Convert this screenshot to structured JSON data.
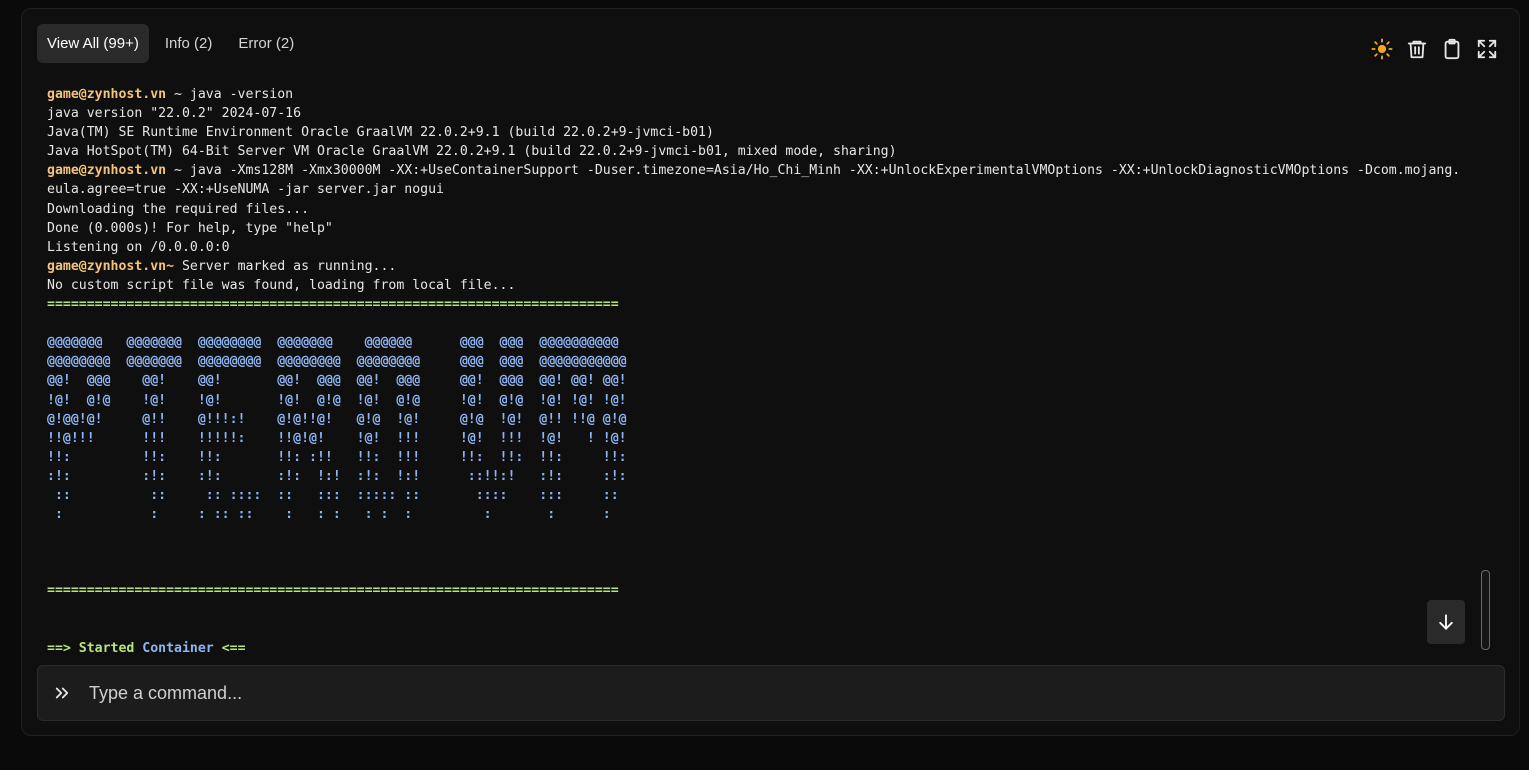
{
  "tabs": [
    {
      "label": "View All (99+)",
      "active": true
    },
    {
      "label": "Info (2)",
      "active": false
    },
    {
      "label": "Error (2)",
      "active": false
    }
  ],
  "toolbar": {
    "icons": [
      "sun-icon",
      "trash-icon",
      "clipboard-icon",
      "expand-icon"
    ],
    "sun_color": "#f5a623"
  },
  "console": {
    "lines": [
      {
        "segments": [
          {
            "text": "game@zynhost.vn",
            "style": "prompt"
          },
          {
            "text": " ~ java -version",
            "style": "plain"
          }
        ]
      },
      {
        "segments": [
          {
            "text": "java version \"22.0.2\" 2024-07-16",
            "style": "plain"
          }
        ]
      },
      {
        "segments": [
          {
            "text": "Java(TM) SE Runtime Environment Oracle GraalVM 22.0.2+9.1 (build 22.0.2+9-jvmci-b01)",
            "style": "plain"
          }
        ]
      },
      {
        "segments": [
          {
            "text": "Java HotSpot(TM) 64-Bit Server VM Oracle GraalVM 22.0.2+9.1 (build 22.0.2+9-jvmci-b01, mixed mode, sharing)",
            "style": "plain"
          }
        ]
      },
      {
        "segments": [
          {
            "text": "game@zynhost.vn",
            "style": "prompt"
          },
          {
            "text": " ~ java -Xms128M -Xmx30000M -XX:+UseContainerSupport -Duser.timezone=Asia/Ho_Chi_Minh -XX:+UnlockExperimentalVMOptions -XX:+UnlockDiagnosticVMOptions -Dcom.mojang.",
            "style": "plain"
          }
        ]
      },
      {
        "segments": [
          {
            "text": "eula.agree=true -XX:+UseNUMA -jar server.jar nogui",
            "style": "plain"
          }
        ]
      },
      {
        "segments": [
          {
            "text": "Downloading the required files...",
            "style": "plain"
          }
        ]
      },
      {
        "segments": [
          {
            "text": "Done (0.000s)! For help, type \"help\"",
            "style": "plain"
          }
        ]
      },
      {
        "segments": [
          {
            "text": "Listening on /0.0.0.0:0",
            "style": "plain"
          }
        ]
      },
      {
        "segments": [
          {
            "text": "game@zynhost.vn~",
            "style": "prompt"
          },
          {
            "text": " Server marked as running...",
            "style": "plain"
          }
        ]
      },
      {
        "segments": [
          {
            "text": "No custom script file was found, loading from local file...",
            "style": "plain"
          }
        ]
      },
      {
        "segments": [
          {
            "text": "========================================================================",
            "style": "sep"
          }
        ]
      },
      {
        "segments": [
          {
            "text": "",
            "style": "plain"
          }
        ]
      },
      {
        "segments": [
          {
            "text": "@@@@@@@   @@@@@@@  @@@@@@@@  @@@@@@@    @@@@@@      @@@  @@@  @@@@@@@@@@",
            "style": "ascii"
          }
        ]
      },
      {
        "segments": [
          {
            "text": "@@@@@@@@  @@@@@@@  @@@@@@@@  @@@@@@@@  @@@@@@@@     @@@  @@@  @@@@@@@@@@@",
            "style": "ascii"
          }
        ]
      },
      {
        "segments": [
          {
            "text": "@@!  @@@    @@!    @@!       @@!  @@@  @@!  @@@     @@!  @@@  @@! @@! @@!",
            "style": "ascii"
          }
        ]
      },
      {
        "segments": [
          {
            "text": "!@!  @!@    !@!    !@!       !@!  @!@  !@!  @!@     !@!  @!@  !@! !@! !@!",
            "style": "ascii"
          }
        ]
      },
      {
        "segments": [
          {
            "text": "@!@@!@!     @!!    @!!!:!    @!@!!@!   @!@  !@!     @!@  !@!  @!! !!@ @!@",
            "style": "ascii"
          }
        ]
      },
      {
        "segments": [
          {
            "text": "!!@!!!      !!!    !!!!!:    !!@!@!    !@!  !!!     !@!  !!!  !@!   ! !@!",
            "style": "ascii"
          }
        ]
      },
      {
        "segments": [
          {
            "text": "!!:         !!:    !!:       !!: :!!   !!:  !!!     !!:  !!:  !!:     !!:",
            "style": "ascii"
          }
        ]
      },
      {
        "segments": [
          {
            "text": ":!:         :!:    :!:       :!:  !:!  :!:  !:!      ::!!:!   :!:     :!:",
            "style": "ascii"
          }
        ]
      },
      {
        "segments": [
          {
            "text": " ::          ::     :: ::::  ::   :::  ::::: ::       ::::    :::     ::",
            "style": "ascii"
          }
        ]
      },
      {
        "segments": [
          {
            "text": " :           :     : :: ::    :   : :   : :  :         :       :      :",
            "style": "ascii"
          }
        ]
      },
      {
        "segments": [
          {
            "text": "",
            "style": "plain"
          }
        ]
      },
      {
        "segments": [
          {
            "text": "",
            "style": "plain"
          }
        ]
      },
      {
        "segments": [
          {
            "text": "",
            "style": "plain"
          }
        ]
      },
      {
        "segments": [
          {
            "text": "========================================================================",
            "style": "sep"
          }
        ]
      },
      {
        "segments": [
          {
            "text": "",
            "style": "plain"
          }
        ]
      },
      {
        "segments": [
          {
            "text": "",
            "style": "plain"
          }
        ]
      },
      {
        "segments": [
          {
            "text": "==> Started ",
            "style": "started-a"
          },
          {
            "text": "Container",
            "style": "started-b"
          },
          {
            "text": " <==",
            "style": "started-a"
          }
        ]
      }
    ]
  },
  "scroll_button": {
    "icon": "arrow-down-icon"
  },
  "command": {
    "placeholder": "Type a command...",
    "value": "",
    "icon": "chevrons-right-icon"
  }
}
